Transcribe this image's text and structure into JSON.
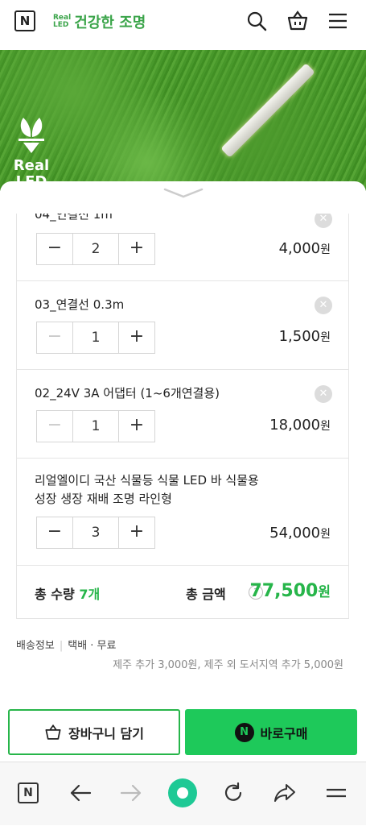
{
  "header": {
    "n_logo": "N",
    "brand_logo_top": "Real",
    "brand_logo_bottom": "LED",
    "brand_title": "건강한 조명"
  },
  "hero": {
    "logo_line1": "Real",
    "logo_line2": "LED"
  },
  "items": [
    {
      "name": "04_연결선 1m",
      "qty": "2",
      "price": "4,000",
      "won": "원"
    },
    {
      "name": "03_연결선 0.3m",
      "qty": "1",
      "price": "1,500",
      "won": "원"
    },
    {
      "name": "02_24V 3A 어댑터 (1~6개연결용)",
      "qty": "1",
      "price": "18,000",
      "won": "원"
    },
    {
      "name_line1": "리얼엘이디 국산 식물등 식물 LED 바 식물용",
      "name_line2": "성장 생장 재배 조명 라인형",
      "qty": "3",
      "price": "54,000",
      "won": "원"
    }
  ],
  "total": {
    "qty_label": "총 수량 ",
    "qty_value": "7개",
    "amount_label": "총 금액",
    "help": "?",
    "amount": "77,500",
    "won": "원"
  },
  "shipping": {
    "label": "배송정보",
    "method": "택배 · 무료",
    "note": "제주 추가 3,000원, 제주 외 도서지역 추가 5,000원"
  },
  "actions": {
    "cart": "장바구니 담기",
    "buy": "바로구매",
    "buy_icon": "N"
  },
  "browser": {
    "n_logo": "N"
  },
  "colors": {
    "accent": "#27b54a",
    "buy_bg": "#1ec95a"
  }
}
